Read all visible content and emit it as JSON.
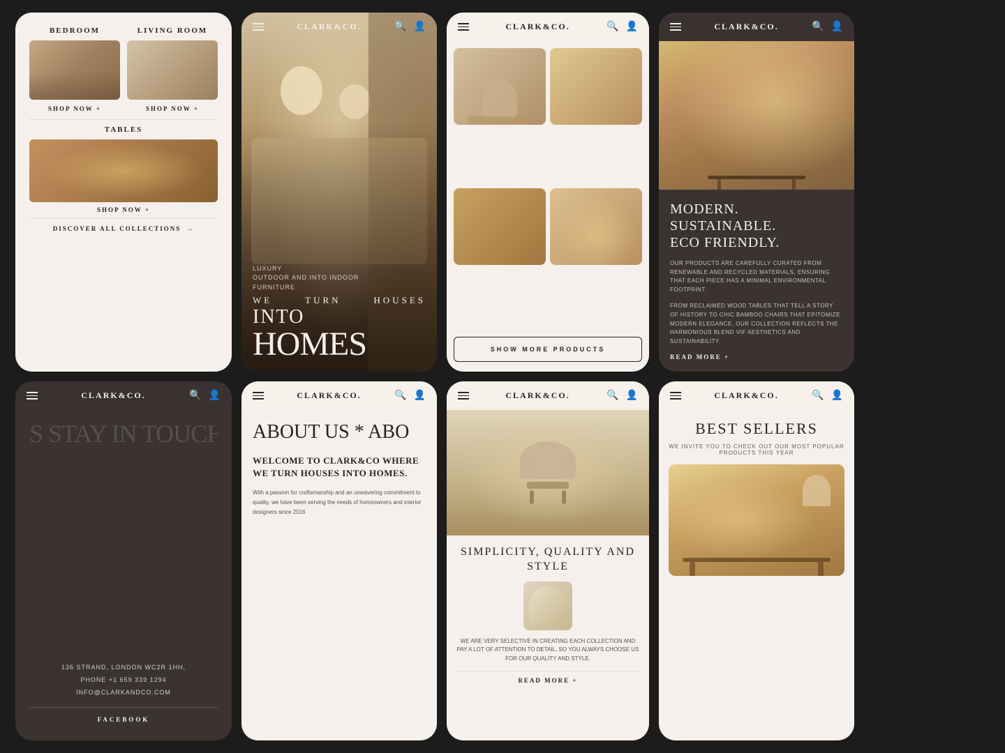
{
  "brand": {
    "logo": "CLARK&CO."
  },
  "card1_collections": {
    "category1_label": "BEDROOM",
    "category2_label": "LIVING ROOM",
    "shop_now_1": "SHOP NOW +",
    "shop_now_2": "SHOP NOW +",
    "category3_label": "TABLES",
    "shop_now_3": "SHOP NOW +",
    "discover_all": "DISCOVER ALL COLLECTIONS",
    "discover_arrow": "→"
  },
  "card2_hero": {
    "headline_row1_left": "WE",
    "headline_row1_mid": "TURN",
    "headline_row1_right": "HOUSES",
    "headline_row2": "INTO",
    "headline_row3": "HOMES",
    "eyebrow_line1": "LUXURY",
    "eyebrow_line2": "OUTDOOR AND INTO INDOOR",
    "eyebrow_line3": "FURNITURE"
  },
  "card3_products": {
    "show_more": "SHOW MORE PRODUCTS"
  },
  "card4_eco": {
    "title_line1": "MODERN. SUSTAINABLE.",
    "title_line2": "ECO FRIENDLY.",
    "body1": "OUR PRODUCTS ARE CAREFULLY CURATED FROM RENEWABLE AND RECYCLED MATERIALS, ENSURING THAT EACH PIECE HAS A MINIMAL ENVIRONMENTAL FOOTPRINT.",
    "body2": "FROM RECLAIMED WOOD TABLES THAT TELL A STORY OF HISTORY TO CHIC BAMBOO CHAIRS THAT EPITOMIZE MODERN ELEGANCE, OUR COLLECTION REFLECTS THE HARMONIOUS BLEND VIF AESTHETICS AND SUSTAINABILITY.",
    "read_more": "READ MORE +"
  },
  "card5_contact": {
    "headline": "S STAY IN TOUCH",
    "address": "136 STRAND, LONDON WC2R 1HH,",
    "phone": "PHONE +1 659 339 1294",
    "email": "INFO@CLARKANDCO.COM",
    "social": "FACEBOOK"
  },
  "card6_about": {
    "marquee": "ABOUT US * ABO",
    "title": "WELCOME TO CLARK&CO WHERE WE TURN HOUSES INTO HOMES.",
    "body": "With a passion for craftsmanship and an unwavering commitment to quality, we have been serving the needs of homeowners and interior designers since 2016"
  },
  "card7_simplicity": {
    "title": "SIMPLICITY, QUALITY AND STYLE",
    "body": "WE ARE VERY SELECTIVE IN CREATING EACH COLLECTION AND PAY A LOT OF ATTENTION TO DETAIL, SO YOU ALWAYS CHOOSE US FOR OUR QUALITY AND STYLE.",
    "read_more": "READ MORE +"
  },
  "card8_bestsellers": {
    "title": "BEST SELLERS",
    "subtitle": "WE INVITE YOU TO CHECK OUT OUR MOST POPULAR PRODUCTS THIS YEAR"
  }
}
